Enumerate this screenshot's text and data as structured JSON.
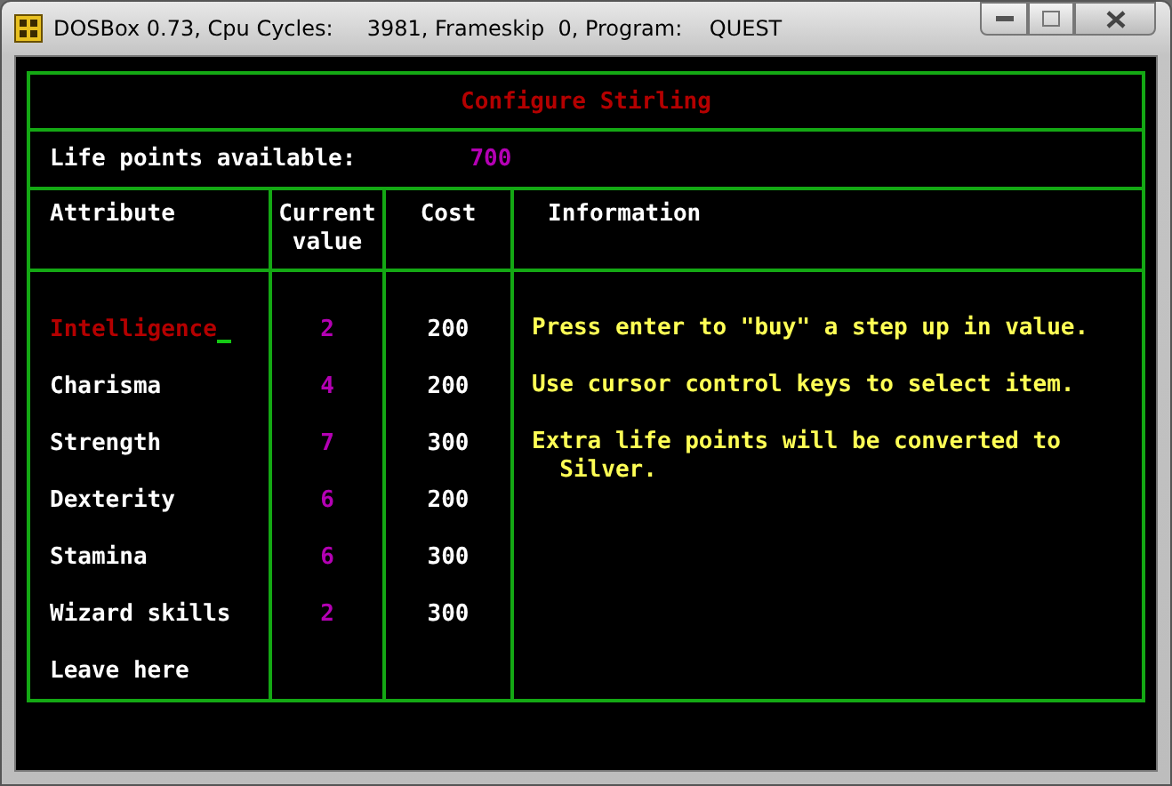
{
  "window": {
    "title": "DOSBox 0.73, Cpu Cycles:     3981, Frameskip  0, Program:    QUEST"
  },
  "screen": {
    "heading": "Configure Stirling",
    "life_points_label": "Life points available:",
    "life_points_value": "700",
    "columns": [
      "Attribute",
      "Current\nvalue",
      "Cost",
      "Information"
    ],
    "rows": [
      {
        "attribute": "Intelligence",
        "value": "2",
        "cost": "200",
        "selected": true
      },
      {
        "attribute": "Charisma",
        "value": "4",
        "cost": "200",
        "selected": false
      },
      {
        "attribute": "Strength",
        "value": "7",
        "cost": "300",
        "selected": false
      },
      {
        "attribute": "Dexterity",
        "value": "6",
        "cost": "200",
        "selected": false
      },
      {
        "attribute": "Stamina",
        "value": "6",
        "cost": "300",
        "selected": false
      },
      {
        "attribute": "Wizard skills",
        "value": "2",
        "cost": "300",
        "selected": false
      },
      {
        "attribute": "Leave here",
        "selected": false
      }
    ],
    "information": [
      "Press enter to \"buy\" a step up in value.",
      "Use cursor control keys to select item.",
      "Extra life points will be converted to\n  Silver."
    ]
  }
}
